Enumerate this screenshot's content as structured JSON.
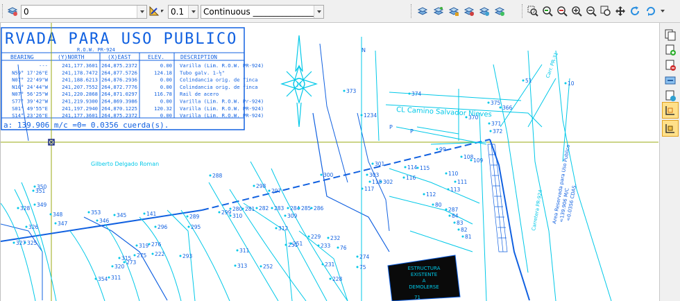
{
  "toolbar": {
    "layer_value": "0",
    "lineweight_value": "0.1",
    "linetype_value": "Continuous _______________",
    "icons": [
      "layer-properties-icon",
      "layer-color-icon",
      "lineweight-icon",
      "layer-manager-icon",
      "layer-isolate-icon",
      "layer-freeze-icon",
      "layer-lock-icon",
      "layer-walk-icon",
      "zoom-window-icon",
      "zoom-previous-icon",
      "zoom-realtime-icon",
      "zoom-in-icon",
      "zoom-extents-icon",
      "zoom-all-icon",
      "pan-icon",
      "regen-icon",
      "refresh-icon"
    ]
  },
  "right_panel": {
    "icons": [
      "copy-object-icon",
      "add-object-icon",
      "remove-object-icon",
      "join-icon",
      "attach-icon",
      "layout-icon",
      "paper-space-icon"
    ]
  },
  "colors": {
    "primary_line": "#1060e0",
    "cyan_line": "#00c8e8",
    "crosshair": "#9aaa10",
    "block_fill": "#0a0a0a"
  },
  "drawing": {
    "title": "RVADA PARA USO PUBLICO",
    "subtitle": "R.O.W. PR-924",
    "table_headers": [
      "BEARING",
      "(Y)NORTH",
      "(X)EAST",
      "ELEV.",
      "DESCRIPTION"
    ],
    "table_rows": [
      [
        "---",
        "241,177.3601",
        "264,875.2372",
        "0.00",
        "Varilla (Lim. R.O.W. PR-924)"
      ],
      [
        "N59° 17'26\"E",
        "241,178.7472",
        "264,877.5726",
        "124.18",
        "Tubo galv. 1-½\""
      ],
      [
        "N07° 22'49\"W",
        "241,188.6213",
        "264,876.2936",
        "0.00",
        "Colindancia orig. de finca"
      ],
      [
        "N10° 24'44\"W",
        "241,207.7552",
        "264,872.7776",
        "0.00",
        "Colindancia orig. de finca"
      ],
      [
        "N07° 56'25\"W",
        "241,220.2868",
        "264,871.0297",
        "116.78",
        "Rail de acero"
      ],
      [
        "S77° 39'42\"W",
        "241,219.9300",
        "264,869.3986",
        "0.00",
        "Varilla (Lim. R.O.W. Pr-924)"
      ],
      [
        "S01° 49'55\"E",
        "241,197.2940",
        "264,870.1225",
        "120.32",
        "Varilla (Lim. R.O.W. PR-924)"
      ],
      [
        "S14° 23'26\"E",
        "241,177.3601",
        "264,875.2372",
        "0.00",
        "Varilla (Lim. R.O.W. PR-924)"
      ]
    ],
    "area_note": "a: 139.906 m/c =0= 0.0356 cuerda(s).",
    "road_label": "CL Camino Salvador Nieves",
    "owner_label": "Gilberto Delgado Roman",
    "block_text": [
      "ESTRUCTURA",
      "EXISTENTE",
      "A",
      "DEMOLERSE"
    ],
    "block_number": "71",
    "side_note": [
      "Area Reservada para Uso Publico",
      "=139.906 M/C",
      "=0.0356 CDAS."
    ],
    "side_road_label": "Carretera PR-924",
    "side_road_label_top": "Carr. PR-31",
    "north_label": "N",
    "point_numbers": [
      "373",
      "374",
      "375",
      "366",
      "51",
      "10",
      "1234",
      "370",
      "99",
      "371",
      "372",
      "108",
      "109",
      "300",
      "301",
      "302",
      "303",
      "114",
      "115",
      "116",
      "117",
      "118",
      "110",
      "111",
      "112",
      "113",
      "288",
      "298",
      "297",
      "310",
      "309",
      "312",
      "251",
      "350",
      "351",
      "349",
      "348",
      "347",
      "346",
      "345",
      "328",
      "326",
      "325",
      "327",
      "353",
      "141",
      "289",
      "295",
      "296",
      "293",
      "251",
      "311",
      "313",
      "252",
      "222",
      "229",
      "228",
      "231",
      "232",
      "233",
      "76",
      "75",
      "274",
      "275",
      "273",
      "276",
      "319",
      "320",
      "315",
      "311",
      "354",
      "299",
      "280",
      "281",
      "282",
      "283",
      "284",
      "285",
      "286",
      "287",
      "84",
      "83",
      "82",
      "81",
      "80",
      "85"
    ],
    "flag_labels": [
      "P",
      "P",
      "N"
    ]
  }
}
